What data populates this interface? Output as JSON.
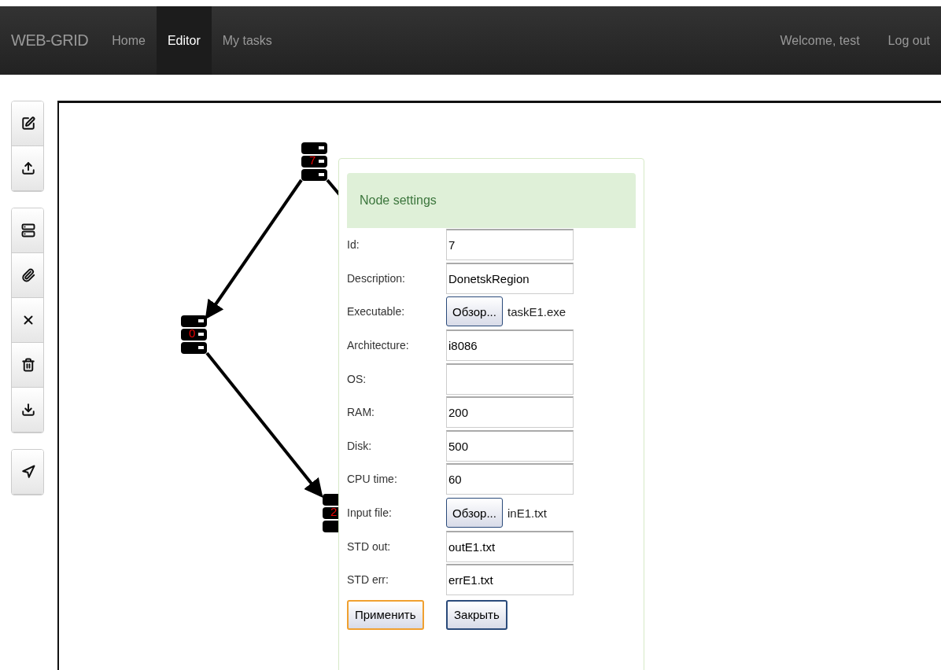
{
  "navbar": {
    "brand": "WEB-GRID",
    "links": [
      {
        "label": "Home",
        "selected": false
      },
      {
        "label": "Editor",
        "selected": true
      },
      {
        "label": "My tasks",
        "selected": false
      }
    ],
    "welcome": "Welcome, test",
    "logout": "Log out"
  },
  "graph": {
    "nodes": [
      {
        "label": "7"
      },
      {
        "label": "0"
      },
      {
        "label": "2"
      }
    ]
  },
  "node_settings": {
    "title": "Node settings",
    "fields": [
      {
        "kind": "text",
        "label": "Id:",
        "value": "7"
      },
      {
        "kind": "text",
        "label": "Description:",
        "value": "DonetskRegion"
      },
      {
        "kind": "file",
        "label": "Executable:",
        "button": "Обзор...",
        "file": "taskE1.exe"
      },
      {
        "kind": "text",
        "label": "Architecture:",
        "value": "i8086"
      },
      {
        "kind": "text",
        "label": "OS:"
      },
      {
        "kind": "text",
        "label": "RAM:",
        "value": "200"
      },
      {
        "kind": "text",
        "label": "Disk:",
        "value": "500"
      },
      {
        "kind": "text",
        "label": "CPU time:",
        "value": "60"
      },
      {
        "kind": "file",
        "label": "Input file:",
        "button": "Обзор...",
        "file": "inE1.txt"
      },
      {
        "kind": "text",
        "label": "STD out:",
        "value": "outE1.txt"
      },
      {
        "kind": "text",
        "label": "STD err:",
        "value": "errE1.txt"
      }
    ],
    "buttons": [
      {
        "label": "Применить",
        "focused": true
      },
      {
        "label": "Закрыть",
        "focused": false
      }
    ]
  }
}
